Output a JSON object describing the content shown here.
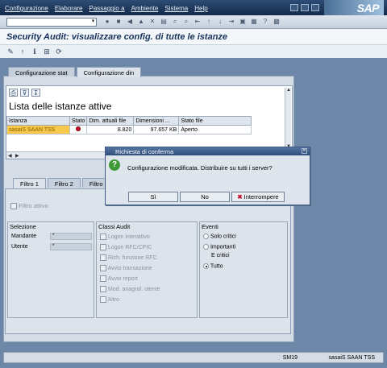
{
  "menubar": {
    "items": [
      "Configurazione",
      "Elaborare",
      "Passaggio a",
      "Ambiente",
      "Sistema",
      "Help"
    ],
    "logo": "SAP"
  },
  "command_field": {
    "value": ""
  },
  "title": "Security Audit: visualizzare config. di tutte le istanze",
  "top_tabs": [
    "Configurazione stat",
    "Configurazione din"
  ],
  "list": {
    "title": "Lista delle istanze attive",
    "columns": [
      "Istanza",
      "Stato",
      "Dim. attuali file",
      "Dimensioni ...",
      "Stato file"
    ],
    "rows": [
      {
        "istanza": "sasaiS SAAN TSS",
        "stato": "red",
        "dim_attuali": "8.820",
        "dimensioni": "97.657 KB",
        "stato_file": "Aperto"
      }
    ]
  },
  "filter_tabs": [
    "Filtro 1",
    "Filtro 2",
    "Filtro 3"
  ],
  "filter": {
    "active_label": "Filtro attivo",
    "selezione": {
      "title": "Selezione",
      "mandante_label": "Mandante",
      "mandante_value": "*",
      "utente_label": "Utente",
      "utente_value": "*"
    },
    "classi_audit": {
      "title": "Classi Audit",
      "items": [
        "Logon interattivo",
        "Logon RFC/CPIC",
        "Rich. funzione RFC",
        "Avvio transazione",
        "Avvio report",
        "Mod. anagraf. utente",
        "Altro"
      ]
    },
    "eventi": {
      "title": "Eventi",
      "options": [
        "Solo critici",
        "Importanti",
        "E critici",
        "Tutto"
      ],
      "selected": "Tutto"
    }
  },
  "dialog": {
    "title": "Richiesta di conferma",
    "message": "Configurazione modificata. Distribuire su tutti i server?",
    "buttons": {
      "yes": "Sì",
      "no": "No",
      "cancel": "Interrompere"
    }
  },
  "statusbar": {
    "transaction": "SM19",
    "server": "sasaiS SAAN TSS"
  }
}
